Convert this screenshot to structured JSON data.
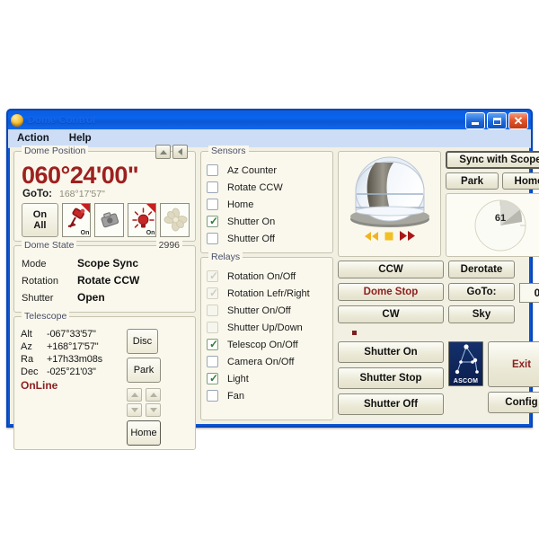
{
  "window": {
    "title": "Dome Control",
    "minimize_label": "Minimize",
    "maximize_label": "Maximize",
    "close_label": "Close"
  },
  "menu": {
    "items": [
      {
        "label": "Action"
      },
      {
        "label": "Help"
      }
    ]
  },
  "dome_position": {
    "legend": "Dome Position",
    "azimuth": "060°24'00\"",
    "goto_label": "GoTo:",
    "goto_value": "168°17'57\"",
    "nav_up_icon": "arrow-up-icon",
    "nav_left_icon": "arrow-left-icon",
    "on_all_label_line1": "On",
    "on_all_label_line2": "All",
    "device_buttons": [
      {
        "name": "telescope-power-button",
        "icon": "telescope-icon",
        "state": "On",
        "active": true
      },
      {
        "name": "camera-power-button",
        "icon": "camera-icon",
        "state": "",
        "active": false
      },
      {
        "name": "light-power-button",
        "icon": "lightbulb-icon",
        "state": "On",
        "active": true
      },
      {
        "name": "fan-power-button",
        "icon": "fan-icon",
        "state": "",
        "active": false
      }
    ]
  },
  "dome_state": {
    "legend": "Dome State",
    "counter": "2996",
    "rows": [
      {
        "label": "Mode",
        "value": "Scope Sync"
      },
      {
        "label": "Rotation",
        "value": "Rotate CCW"
      },
      {
        "label": "Shutter",
        "value": "Open"
      }
    ]
  },
  "telescope": {
    "legend": "Telescope",
    "rows": [
      {
        "label": "Alt",
        "value": "-067°33'57\""
      },
      {
        "label": "Az",
        "value": "+168°17'57\""
      },
      {
        "label": "Ra",
        "value": "+17h33m08s"
      },
      {
        "label": "Dec",
        "value": "-025°21'03\""
      }
    ],
    "status": "OnLine",
    "disc_label": "Disc",
    "park_label": "Park",
    "home_label": "Home"
  },
  "sensors": {
    "legend": "Sensors",
    "items": [
      {
        "label": "Az Counter",
        "checked": false,
        "disabled": false
      },
      {
        "label": "Rotate CCW",
        "checked": false,
        "disabled": false
      },
      {
        "label": "Home",
        "checked": false,
        "disabled": false
      },
      {
        "label": "Shutter On",
        "checked": true,
        "disabled": false
      },
      {
        "label": "Shutter Off",
        "checked": false,
        "disabled": false
      }
    ]
  },
  "relays": {
    "legend": "Relays",
    "items": [
      {
        "label": "Rotation On/Off",
        "checked": true,
        "disabled": true
      },
      {
        "label": "Rotation Lefr/Right",
        "checked": true,
        "disabled": true
      },
      {
        "label": "Shutter On/Off",
        "checked": false,
        "disabled": true
      },
      {
        "label": "Shutter Up/Down",
        "checked": false,
        "disabled": true
      },
      {
        "label": "Telescop On/Off",
        "checked": true,
        "disabled": false
      },
      {
        "label": "Camera On/Off",
        "checked": false,
        "disabled": false
      },
      {
        "label": "Light",
        "checked": true,
        "disabled": false
      },
      {
        "label": "Fan",
        "checked": false,
        "disabled": false
      }
    ]
  },
  "dome_view": {
    "playback": {
      "rewind_icon": "rewind-icon",
      "stop_icon": "stop-icon",
      "forward_icon": "fast-forward-icon"
    },
    "dome_icon": "observatory-dome-icon"
  },
  "scope_panel": {
    "sync_label": "Sync with Scope",
    "park_label": "Park",
    "home_label": "Home",
    "dial_value": "61"
  },
  "controls": {
    "ccw_label": "CCW",
    "dome_stop_label": "Dome Stop",
    "cw_label": "CW",
    "derotate_label": "Derotate",
    "goto_label": "GoTo:",
    "sky_label": "Sky",
    "goto_value": "0",
    "shutter_on_label": "Shutter On",
    "shutter_stop_label": "Shutter Stop",
    "shutter_off_label": "Shutter Off",
    "exit_label": "Exit",
    "config_label": "Config",
    "ascom_label": "ASCOM"
  },
  "colors": {
    "accent_red": "#9e2020",
    "title_blue": "#0a64ee",
    "panel_bg": "#faf8ec",
    "client_bg": "#f2f0e2"
  }
}
